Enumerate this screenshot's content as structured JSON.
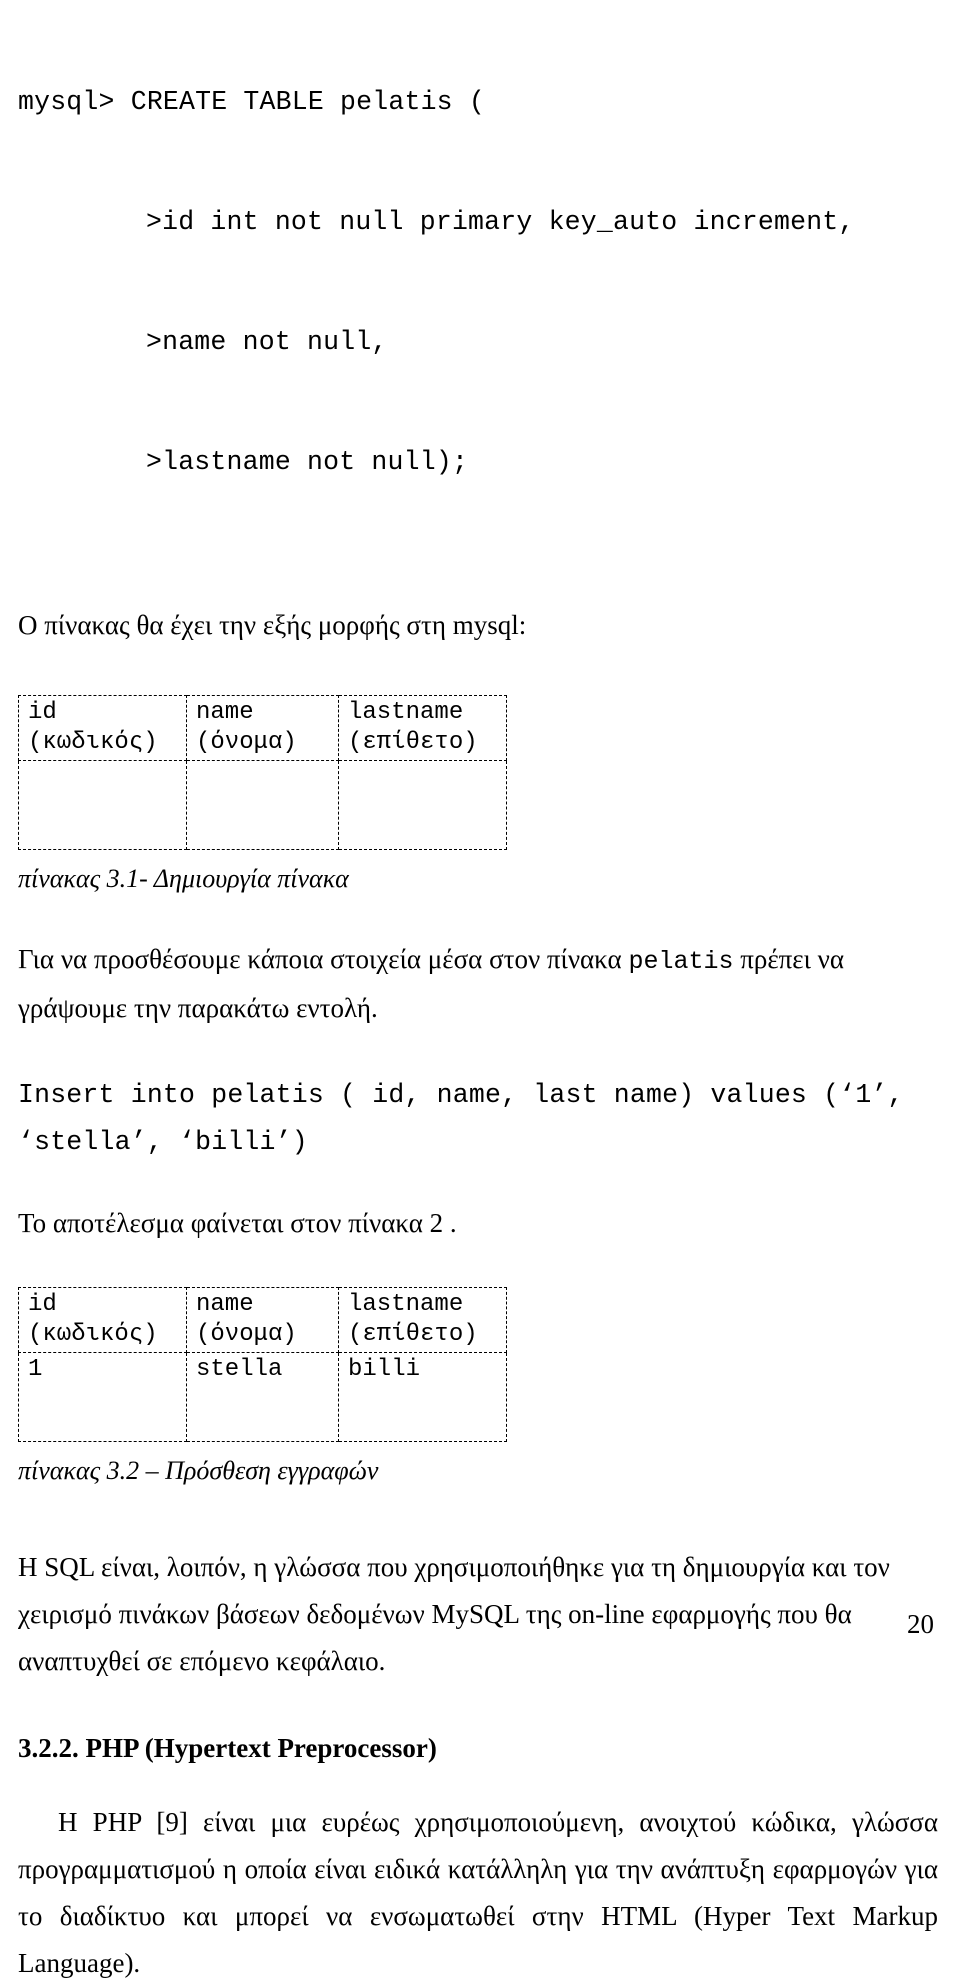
{
  "document": {
    "page_number": "20"
  },
  "code_block_1": {
    "lines": [
      "mysql> CREATE TABLE pelatis (",
      ">id int not null primary key_auto increment,",
      ">name not null,",
      ">lastname not null);"
    ]
  },
  "intro_paragraph": {
    "text": "Ο πίνακας θα έχει την εξής μορφής στη mysql:"
  },
  "table_1": {
    "headers": [
      {
        "name": "id",
        "greek": "(κωδικός)"
      },
      {
        "name": "name",
        "greek": "(όνομα)"
      },
      {
        "name": "lastname",
        "greek": "(επίθετο)"
      }
    ],
    "rows": [
      [
        "",
        "",
        ""
      ]
    ],
    "caption": "πίνακας 3.1- Δημιουργία πίνακα"
  },
  "paragraph_insert": {
    "part_1": "Για να προσθέσουμε κάποια στοιχεία μέσα στον πίνακα ",
    "code": "pelatis",
    "part_2": " πρέπει να γράψουμε την παρακάτω εντολή."
  },
  "code_block_2": {
    "line_1": "Insert into pelatis ( id, name, last name) values (‘1’,",
    "line_2": "‘stella’, ‘billi’)"
  },
  "paragraph_result": {
    "text": "Το αποτέλεσμα φαίνεται στον πίνακα 2 ."
  },
  "table_2": {
    "headers": [
      {
        "name": "id",
        "greek": "(κωδικός)"
      },
      {
        "name": "name",
        "greek": "(όνομα)"
      },
      {
        "name": "lastname",
        "greek": "(επίθετο)"
      }
    ],
    "rows": [
      [
        "1",
        "stella",
        "billi"
      ]
    ],
    "caption": "πίνακας 3.2 – Πρόσθεση εγγραφών"
  },
  "paragraph_sql": {
    "text": "Η SQL είναι, λοιπόν, η γλώσσα που χρησιμοποιήθηκε για τη δημιουργία και τον χειρισμό πινάκων βάσεων δεδομένων MySQL  της on-line εφαρμογής που θα αναπτυχθεί σε επόμενο κεφάλαιο."
  },
  "section_heading": {
    "text": "3.2.2. PHP (Hypertext Preprocessor)"
  },
  "paragraph_php": {
    "text": "Η PHP [9] είναι μια ευρέως χρησιμοποιούμενη, ανοιχτού κώδικα, γλώσσα προγραμματισμού η οποία είναι ειδικά κατάλληλη για την ανάπτυξη εφαρμογών για το διαδίκτυο και μπορεί να ενσωματωθεί στην HTML (Hyper Text Markup Language)."
  }
}
